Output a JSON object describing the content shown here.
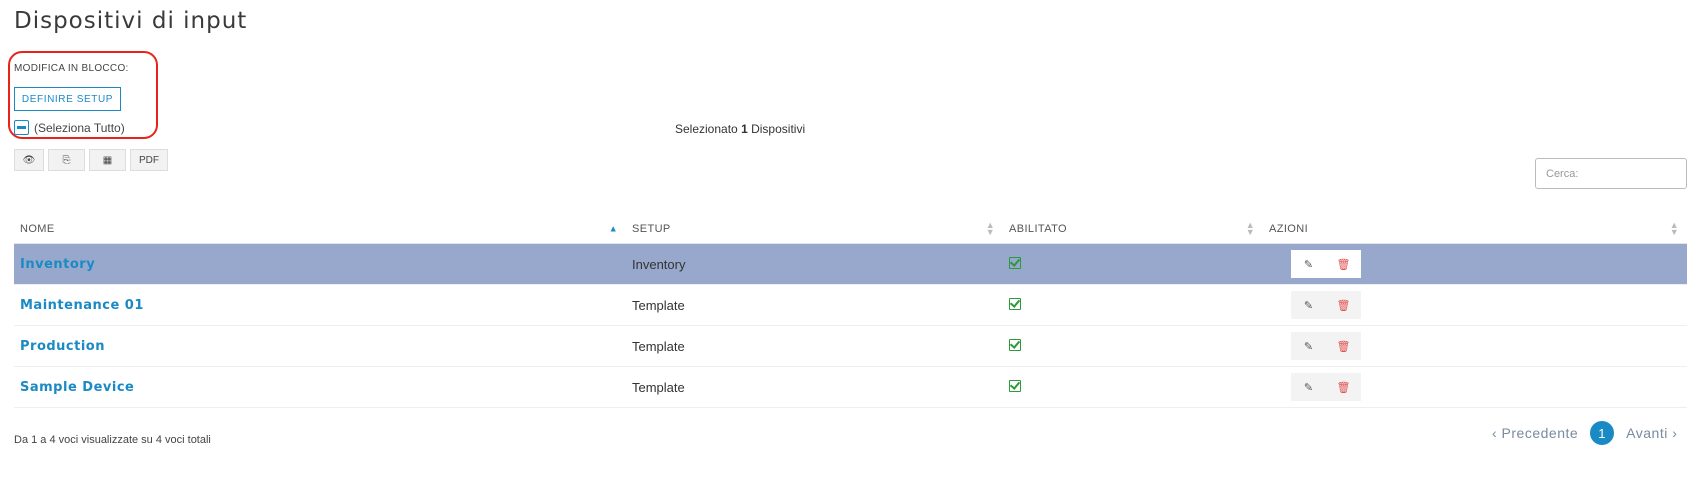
{
  "page": {
    "title": "Dispositivi di input"
  },
  "bulk_edit": {
    "label": "MODIFICA IN BLOCCO:",
    "setup_button": "DEFINIRE SETUP",
    "select_all": "(Seleziona Tutto)"
  },
  "selection": {
    "prefix": "Selezionato",
    "count": "1",
    "suffix": "Dispositivi"
  },
  "export_buttons": [
    {
      "icon": "eye-icon",
      "label": "👁"
    },
    {
      "icon": "copy-icon",
      "label": "⎘"
    },
    {
      "icon": "table-icon",
      "label": "▦"
    },
    {
      "icon": "pdf-icon",
      "label": "PDF"
    }
  ],
  "search": {
    "placeholder": "Cerca:"
  },
  "table": {
    "columns": [
      "NOME",
      "SETUP",
      "ABILITATO",
      "AZIONI"
    ],
    "sorted_column": "NOME",
    "rows": [
      {
        "name": "Inventory",
        "setup": "Inventory",
        "enabled": true,
        "selected": true
      },
      {
        "name": "Maintenance 01",
        "setup": "Template",
        "enabled": true,
        "selected": false
      },
      {
        "name": "Production",
        "setup": "Template",
        "enabled": true,
        "selected": false
      },
      {
        "name": "Sample Device",
        "setup": "Template",
        "enabled": true,
        "selected": false
      }
    ]
  },
  "footer": {
    "info": "Da 1 a 4 voci visualizzate su 4 voci totali",
    "prev": "‹ Precedente",
    "current_page": "1",
    "next": "Avanti ›"
  },
  "colors": {
    "accent": "#1a8ac4",
    "selected_row": "#97a8cc",
    "highlight_outline": "#e8231a",
    "enabled_check": "#2a9a3a",
    "delete": "#e05050"
  }
}
